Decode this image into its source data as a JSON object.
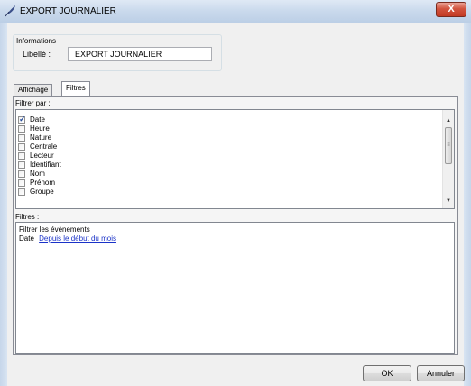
{
  "window": {
    "title": "EXPORT JOURNALIER",
    "close_label": "X"
  },
  "informations": {
    "group_title": "Informations",
    "libelle_label": "Libellé :",
    "libelle_value": "EXPORT JOURNALIER"
  },
  "tabs": [
    {
      "label": "Affichage",
      "active": false
    },
    {
      "label": "Filtres",
      "active": true
    }
  ],
  "filtrer_par": {
    "label": "Filtrer par :",
    "items": [
      {
        "label": "Date",
        "checked": true
      },
      {
        "label": "Heure",
        "checked": false
      },
      {
        "label": "Nature",
        "checked": false
      },
      {
        "label": "Centrale",
        "checked": false
      },
      {
        "label": "Lecteur",
        "checked": false
      },
      {
        "label": "Identifiant",
        "checked": false
      },
      {
        "label": "Nom",
        "checked": false
      },
      {
        "label": "Prénom",
        "checked": false
      },
      {
        "label": "Groupe",
        "checked": false
      }
    ]
  },
  "filtres": {
    "label": "Filtres :",
    "line1": "Filtrer les évènements",
    "date_label": "Date",
    "date_link": "Depuis le début du mois"
  },
  "buttons": {
    "ok": "OK",
    "cancel": "Annuler"
  }
}
